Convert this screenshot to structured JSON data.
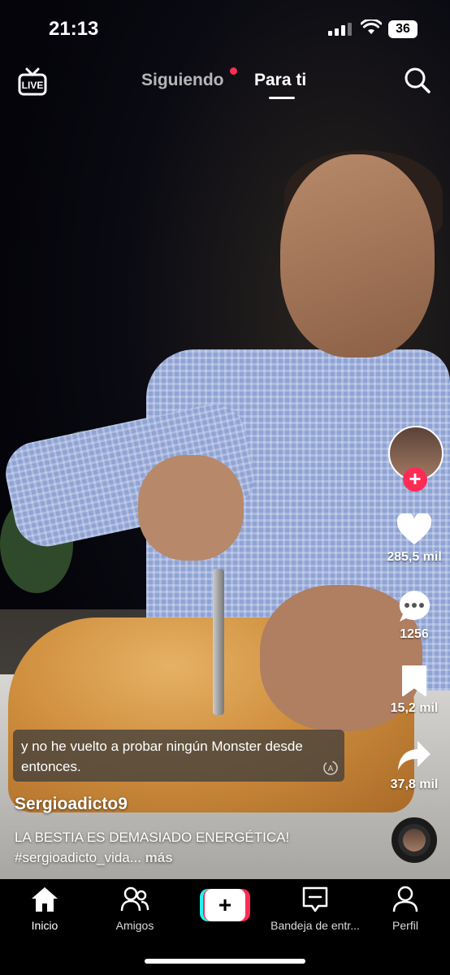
{
  "status_bar": {
    "time": "21:13",
    "battery": "36"
  },
  "top_nav": {
    "live_label": "LIVE",
    "tabs": [
      {
        "label": "Siguiendo",
        "has_dot": true
      },
      {
        "label": "Para ti",
        "active": true
      }
    ]
  },
  "actions": {
    "likes": "285,5 mil",
    "comments": "1256",
    "saves": "15,2 mil",
    "shares": "37,8 mil"
  },
  "caption_overlay": "y no he vuelto a probar ningún Monster desde entonces.",
  "post": {
    "username": "Sergioadicto9",
    "description": "LA BESTIA ES DEMASIADO ENERGÉTICA! #sergioadicto_vida...",
    "more_label": "más"
  },
  "bottom_nav": [
    {
      "label": "Inicio",
      "icon": "home-icon"
    },
    {
      "label": "Amigos",
      "icon": "friends-icon"
    },
    {
      "label": "+",
      "icon": "create-icon"
    },
    {
      "label": "Bandeja de entr...",
      "icon": "inbox-icon"
    },
    {
      "label": "Perfil",
      "icon": "profile-icon"
    }
  ],
  "colors": {
    "accent_red": "#fe2c55",
    "accent_cyan": "#25f4ee"
  }
}
